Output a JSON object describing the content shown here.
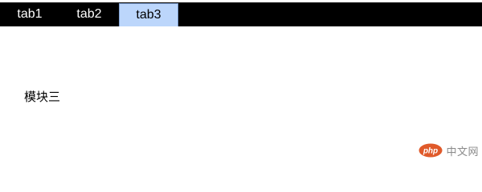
{
  "tabs": [
    {
      "label": "tab1",
      "active": false
    },
    {
      "label": "tab2",
      "active": false
    },
    {
      "label": "tab3",
      "active": true
    }
  ],
  "panel": {
    "text": "模块三"
  },
  "watermark": {
    "logo_text": "php",
    "site_text": "中文网"
  },
  "colors": {
    "tabbar_bg": "#000000",
    "active_tab_bg": "#bcd6fb",
    "watermark_logo": "#e05a2a"
  }
}
